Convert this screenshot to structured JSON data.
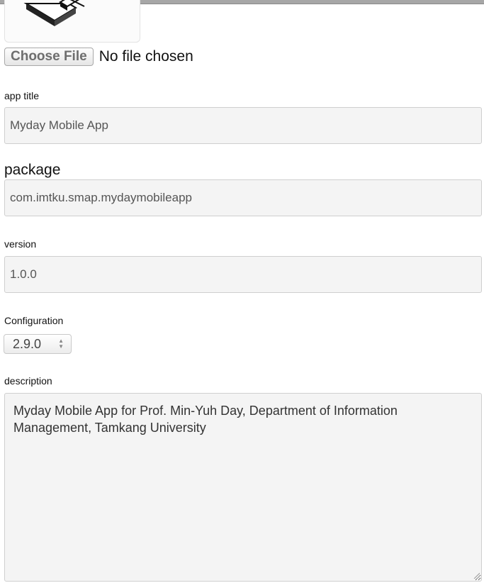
{
  "file_picker": {
    "button_label": "Choose File",
    "status": "No file chosen"
  },
  "app_title": {
    "label": "app title",
    "value": "Myday Mobile App"
  },
  "package": {
    "label": "package",
    "value": "com.imtku.smap.mydaymobileapp"
  },
  "version": {
    "label": "version",
    "value": "1.0.0"
  },
  "configuration": {
    "label": "Configuration",
    "selected": "2.9.0"
  },
  "description": {
    "label": "description",
    "value": "Myday Mobile App for Prof. Min-Yuh Day, Department of Information Management, Tamkang University"
  }
}
